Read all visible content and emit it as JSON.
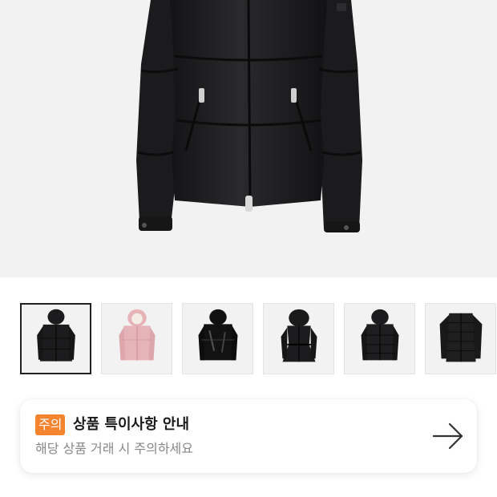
{
  "product": {
    "main_image": "black-down-puffer-jacket-photo"
  },
  "thumbnails": [
    {
      "image": "black-hooded-puffer-matte",
      "selected": true
    },
    {
      "image": "pink-hooded-puffer-fur"
    },
    {
      "image": "black-hooded-puffer-glossy"
    },
    {
      "image": "black-hooded-puffer-fur-belted"
    },
    {
      "image": "black-hooded-puffer-quilted"
    },
    {
      "image": "black-lightweight-quilted-jacket"
    }
  ],
  "notice": {
    "badge": "주의",
    "title": "상품 특이사항 안내",
    "subtitle": "해당 상품 거래 시 주의하세요",
    "arrow_icon": "arrow-right-icon"
  },
  "colors": {
    "badge": "#f5842f",
    "hero_bg": "#f2f2f2",
    "jacket": "#1c1c1e",
    "pink_jacket": "#e6b3b8"
  }
}
